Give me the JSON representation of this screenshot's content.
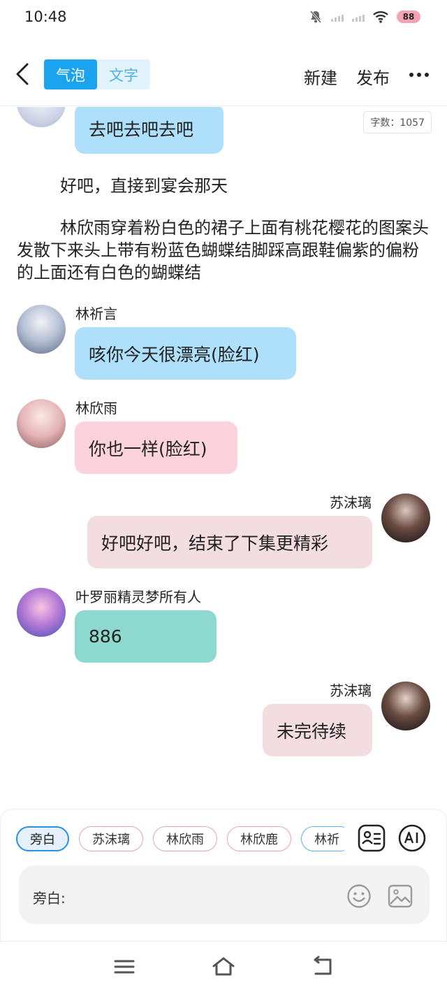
{
  "status": {
    "time": "10:48",
    "battery": "88"
  },
  "header": {
    "tab_bubble": "气泡",
    "tab_text": "文字",
    "new_label": "新建",
    "publish_label": "发布"
  },
  "content": {
    "word_count": "字数：1057",
    "top_bubble": "去吧去吧去吧",
    "narration_1": "好吧，直接到宴会那天",
    "narration_2": "林欣雨穿着粉白色的裙子上面有桃花樱花的图案头发散下来头上带有粉蓝色蝴蝶结脚踩高跟鞋偏紫的偏粉的上面还有白色的蝴蝶结",
    "messages": [
      {
        "name": "林祈言",
        "text": "咳你今天很漂亮(脸红)"
      },
      {
        "name": "林欣雨",
        "text": "你也一样(脸红)"
      },
      {
        "name": "苏沫璃",
        "text": "好吧好吧，结束了下集更精彩"
      },
      {
        "name": "叶罗丽精灵梦所有人",
        "text": "886"
      },
      {
        "name": "苏沫璃",
        "text": "未完待续"
      }
    ]
  },
  "composer": {
    "chips": [
      "旁白",
      "苏沫璃",
      "林欣雨",
      "林欣鹿",
      "林祈"
    ],
    "input_label": "旁白:"
  },
  "colors": {
    "accent": "#1aa3ef",
    "bubble_blue": "#aee0fb",
    "bubble_pink": "#fcd3dd",
    "bubble_rose": "#f3dde0",
    "bubble_teal": "#8dd8cf"
  }
}
